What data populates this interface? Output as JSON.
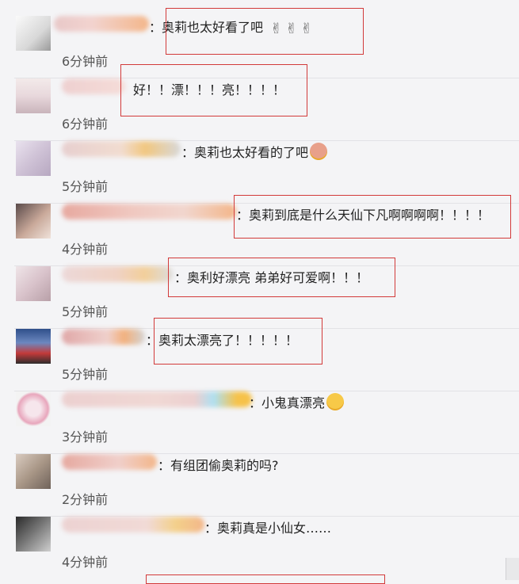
{
  "comments": [
    {
      "text": "奥莉也太好看了吧",
      "time": "6分钟前",
      "trail": "hands"
    },
    {
      "text": "好！！漂！！！亮！！！！",
      "time": "6分钟前",
      "trail": ""
    },
    {
      "text": "奥莉也太好看的了吧",
      "time": "5分钟前",
      "trail": "face"
    },
    {
      "text": "奥莉到底是什么天仙下凡啊啊啊啊！！！！",
      "time": "4分钟前",
      "trail": ""
    },
    {
      "text": "奥利好漂亮 弟弟好可爱啊！！！",
      "time": "5分钟前",
      "trail": ""
    },
    {
      "text": "奥莉太漂亮了！！！！！",
      "time": "5分钟前",
      "trail": ""
    },
    {
      "text": "小鬼真漂亮",
      "time": "3分钟前",
      "trail": "smile"
    },
    {
      "text": "有组团偷奥莉的吗?",
      "time": "2分钟前",
      "trail": ""
    },
    {
      "text": "奥莉真是小仙女……",
      "time": "4分钟前",
      "trail": ""
    }
  ],
  "colon": "：",
  "colors": {
    "highlight_box": "#d23a3a",
    "background": "#f4f4f6",
    "time_text": "#555555"
  },
  "icons": {
    "hands": "waving-hand-icon",
    "face": "blushing-face-icon",
    "smile": "smiling-face-icon"
  }
}
